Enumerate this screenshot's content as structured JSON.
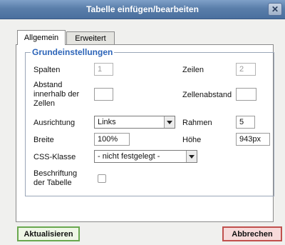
{
  "dialog": {
    "title": "Tabelle einfügen/bearbeiten",
    "close_symbol": "✕"
  },
  "tabs": [
    {
      "label": "Allgemein",
      "active": true
    },
    {
      "label": "Erweitert",
      "active": false
    }
  ],
  "section": {
    "legend": "Grundeinstellungen"
  },
  "fields": {
    "columns": {
      "label": "Spalten",
      "value": "1",
      "disabled": true
    },
    "rows": {
      "label": "Zeilen",
      "value": "2",
      "disabled": true
    },
    "cellpadding": {
      "label_lines": [
        "Abstand",
        "innerhalb der",
        "Zellen"
      ],
      "value": ""
    },
    "cellspacing": {
      "label": "Zellenabstand",
      "value": ""
    },
    "alignment": {
      "label": "Ausrichtung",
      "value": "Links"
    },
    "border": {
      "label": "Rahmen",
      "value": "5"
    },
    "width": {
      "label": "Breite",
      "value": "100%"
    },
    "height": {
      "label": "Höhe",
      "value": "943px"
    },
    "css_class": {
      "label": "CSS-Klasse",
      "value": "- nicht festgelegt -"
    },
    "caption": {
      "label_lines": [
        "Beschriftung",
        "der Tabelle"
      ],
      "checked": false
    }
  },
  "buttons": {
    "update": "Aktualisieren",
    "cancel": "Abbrechen"
  },
  "colors": {
    "title_bar": "#5a7eaa",
    "legend": "#2c64b8",
    "update_border": "#6aa84f",
    "cancel_border": "#c0504d"
  }
}
